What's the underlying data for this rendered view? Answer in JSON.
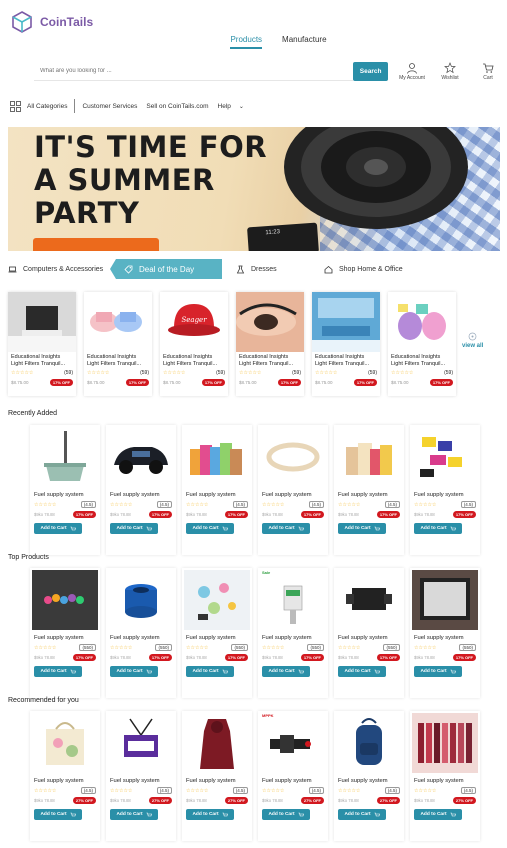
{
  "brand": {
    "name": "CoinTails",
    "color": "#7b5aa6"
  },
  "main_tabs": [
    {
      "label": "Products",
      "active": true
    },
    {
      "label": "Manufacture",
      "active": false
    }
  ],
  "search": {
    "placeholder": "What are you looking for ...",
    "button": "Search"
  },
  "header_icons": [
    {
      "label": "My Account",
      "icon": "user-icon"
    },
    {
      "label": "Wishlist",
      "icon": "star-icon"
    },
    {
      "label": "Cart",
      "icon": "cart-icon"
    }
  ],
  "nav": {
    "all_categories": "All Categories",
    "customer_services": "Customer Services",
    "sell": "Sell on CoinTails.com",
    "help": "Help"
  },
  "banner": {
    "title_line1": "IT'S TIME FOR",
    "title_line2": "A SUMMER",
    "title_line3": "PARTY",
    "device_time": "11:23"
  },
  "category_tabs": [
    {
      "label": "Computers & Accessories",
      "icon": "laptop-icon",
      "active": false
    },
    {
      "label": "Deal of the Day",
      "icon": "tag-icon",
      "active": true
    },
    {
      "label": "Dresses",
      "icon": "dress-icon",
      "active": false
    },
    {
      "label": "Shop Home & Office",
      "icon": "home-icon",
      "active": false
    }
  ],
  "deals": [
    {
      "name": "Educational Insights Light Filters Tranquil...",
      "reviews": "(59)",
      "price": "$8.75.00",
      "badge": "17% OFF"
    },
    {
      "name": "Educational Insights Light Filters Tranquil...",
      "reviews": "(59)",
      "price": "$8.75.00",
      "badge": "17% OFF"
    },
    {
      "name": "Educational Insights Light Filters Tranquil...",
      "reviews": "(59)",
      "price": "$8.75.00",
      "badge": "17% OFF"
    },
    {
      "name": "Educational Insights Light Filters Tranquil...",
      "reviews": "(59)",
      "price": "$8.75.00",
      "badge": "17% OFF"
    },
    {
      "name": "Educational Insights Light Filters Tranquil...",
      "reviews": "(59)",
      "price": "$8.75.00",
      "badge": "17% OFF"
    },
    {
      "name": "Educational Insights Light Filters Tranquil...",
      "reviews": "(59)",
      "price": "$8.75.00",
      "badge": "17% OFF"
    }
  ],
  "view_all": "view all",
  "sections": [
    {
      "title": "Recently Added"
    },
    {
      "title": "Top Products"
    },
    {
      "title": "Recommended for you"
    }
  ],
  "product": {
    "name": "Fuel supply system",
    "rating": "(4.5)",
    "alt_rating": "(550)",
    "price": "$9ko 78.88",
    "badge": "17% OFF",
    "badge_alt": "27% OFF",
    "add_to_cart": "Add to Cart"
  },
  "tags": {
    "mppk": "MPPK",
    "green": "Sale"
  }
}
